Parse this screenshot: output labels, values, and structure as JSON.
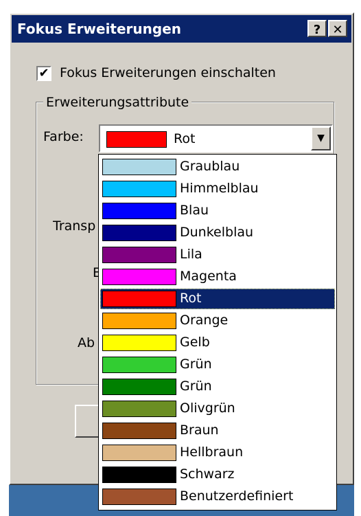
{
  "window": {
    "title": "Fokus Erweiterungen",
    "help_label": "?",
    "close_label": "✕"
  },
  "enable": {
    "label": "Fokus Erweiterungen einschalten",
    "checked": true,
    "check_glyph": "✔"
  },
  "group": {
    "label": "Erweiterungsattribute",
    "farbe_label": "Farbe:",
    "partial_labels": [
      "Transp",
      "E",
      "Ab"
    ]
  },
  "combo": {
    "value": "Rot",
    "swatch_color": "#ff0000",
    "arrow_icon": "▼"
  },
  "dropdown": {
    "items": [
      {
        "label": "Graublau",
        "color": "#add8e6"
      },
      {
        "label": "Himmelblau",
        "color": "#00bfff"
      },
      {
        "label": "Blau",
        "color": "#0000ff"
      },
      {
        "label": "Dunkelblau",
        "color": "#00008b"
      },
      {
        "label": "Lila",
        "color": "#800080"
      },
      {
        "label": "Magenta",
        "color": "#ff00ff"
      },
      {
        "label": "Rot",
        "color": "#ff0000",
        "selected": true
      },
      {
        "label": "Orange",
        "color": "#ffa500"
      },
      {
        "label": "Gelb",
        "color": "#ffff00"
      },
      {
        "label": "Grün",
        "color": "#32cd32"
      },
      {
        "label": "Grün",
        "color": "#008000"
      },
      {
        "label": "Olivgrün",
        "color": "#6b8e23"
      },
      {
        "label": "Braun",
        "color": "#8b4513"
      },
      {
        "label": "Hellbraun",
        "color": "#deb887"
      },
      {
        "label": "Schwarz",
        "color": "#000000"
      },
      {
        "label": "Benutzerdefiniert",
        "color": "#a0522d"
      }
    ]
  }
}
